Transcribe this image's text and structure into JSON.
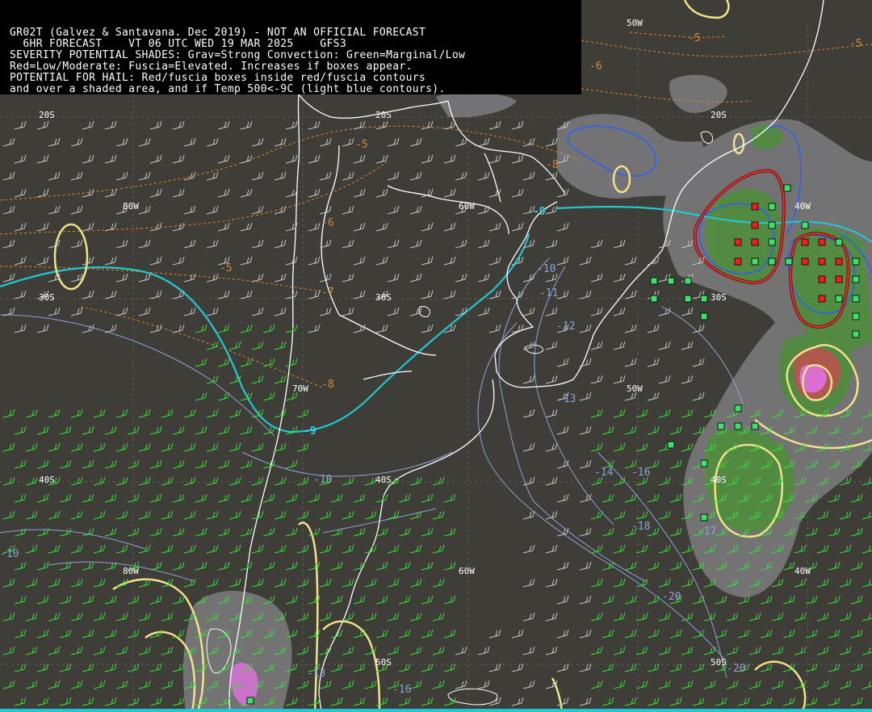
{
  "header": {
    "line1": "GR02T (Galvez & Santavana. Dec 2019) - NOT AN OFFICIAL FORECAST",
    "line2": "  6HR FORECAST    VT 06 UTC WED 19 MAR 2025    GFS3",
    "line3": "SEVERITY POTENTIAL SHADES: Grav=Strong Convection: Green=Marginal/Low",
    "line4": "Red=Low/Moderate: Fuscia=Elevated. Increases if boxes appear.",
    "line5": "POTENTIAL FOR HAIL: Red/fuscia boxes inside red/fuscia contours",
    "line6": "and over a shaded area, and if Temp 500<-9C (light blue contours)."
  },
  "grid_labels": [
    "50W",
    "20S",
    "20S",
    "20S",
    "80W",
    "60W",
    "40W",
    "30S",
    "30S",
    "30S",
    "70W",
    "50W",
    "40S",
    "40S",
    "40S",
    "60W",
    "80W",
    "40W",
    "50S",
    "50S"
  ],
  "contour_labels_orange": [
    "-5",
    "-5",
    "-6",
    "-5",
    "-8",
    "-6",
    "-5",
    "-7",
    "-8"
  ],
  "contour_labels_blue": [
    "-10",
    "-11",
    "-12",
    "-13",
    "-10",
    "-14",
    "-16",
    "-18",
    "-17",
    "-20",
    "-20",
    "-16",
    "-13",
    "-10"
  ],
  "contour_labels_cyan": [
    "-9",
    "-9"
  ],
  "colors": {
    "background": "#3e3d38",
    "land_outline": "#ffffff",
    "gray_shade": "#7d7c7f",
    "green_shade": "#4d8f3a",
    "red_shade": "#c0504d",
    "fuchsia_shade": "#e070e0",
    "red_contour": "#8b1010",
    "yellow_contour": "#f2e28a",
    "cyan_contour": "#21c8cf",
    "blue_contour": "#2a5fff",
    "orange_contour": "#d98a2a",
    "wind_green": "#3de03d",
    "wind_white": "#c8c8c8"
  }
}
